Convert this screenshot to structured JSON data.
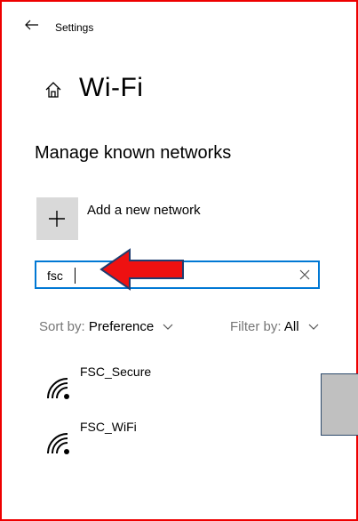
{
  "titlebar": {
    "back_icon": "back-arrow-icon",
    "title": "Settings"
  },
  "header": {
    "home_icon": "home-icon",
    "title": "Wi-Fi"
  },
  "section": {
    "title": "Manage known networks"
  },
  "add_network": {
    "icon": "plus-icon",
    "label": "Add a new network"
  },
  "search": {
    "value": "fsc",
    "clear_icon": "close-icon"
  },
  "sort": {
    "prefix": "Sort by:",
    "value": "Preference"
  },
  "filter": {
    "prefix": "Filter by:",
    "value": "All"
  },
  "networks": [
    {
      "name": "FSC_Secure",
      "icon": "wifi-signal-icon"
    },
    {
      "name": "FSC_WiFi",
      "icon": "wifi-signal-icon"
    }
  ],
  "colors": {
    "frame": "#ee0000",
    "accent": "#0078d4",
    "arrow": "#ee0000",
    "muted": "#767676"
  }
}
